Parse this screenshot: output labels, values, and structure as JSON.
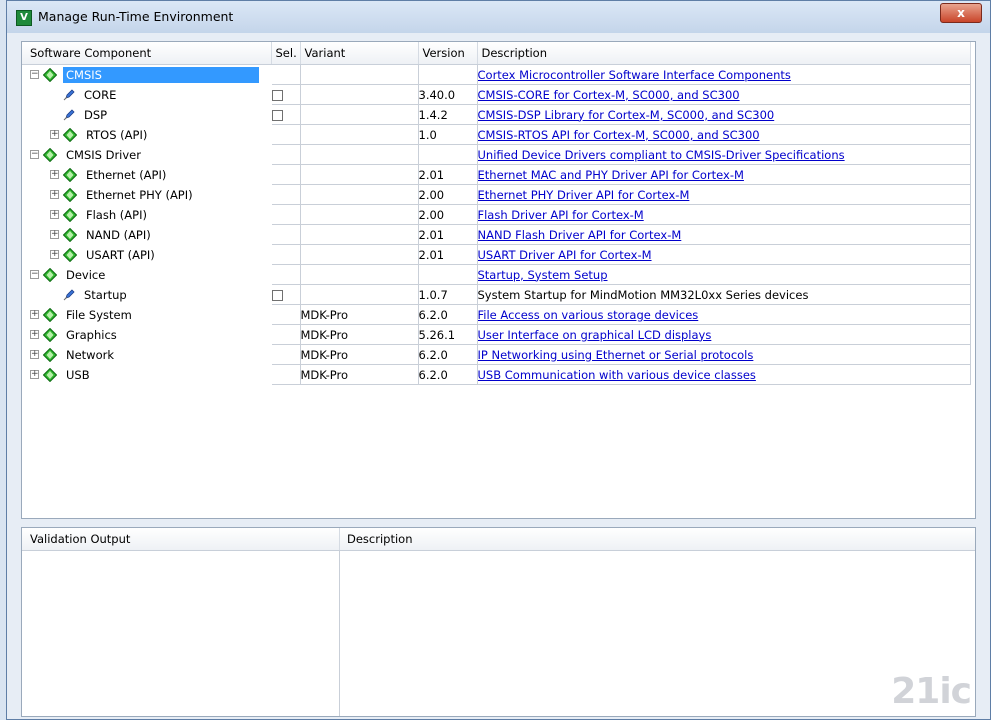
{
  "window": {
    "title": "Manage Run-Time Environment",
    "close_glyph": "x"
  },
  "columns": {
    "component": "Software Component",
    "sel": "Sel.",
    "variant": "Variant",
    "version": "Version",
    "description": "Description"
  },
  "rows": [
    {
      "name": "CMSIS",
      "level": 0,
      "icon": "diamond-icon",
      "expander": "minus",
      "selected": true,
      "checkbox": false,
      "variant": "",
      "version": "",
      "description": "Cortex Microcontroller Software Interface Components",
      "link": true
    },
    {
      "name": "CORE",
      "level": 1,
      "icon": "pin-icon",
      "expander": "none",
      "selected": false,
      "checkbox": true,
      "variant": "",
      "version": "3.40.0",
      "description": "CMSIS-CORE for Cortex-M, SC000, and SC300",
      "link": true
    },
    {
      "name": "DSP",
      "level": 1,
      "icon": "pin-icon",
      "expander": "none",
      "selected": false,
      "checkbox": true,
      "variant": "",
      "version": "1.4.2",
      "description": "CMSIS-DSP Library for Cortex-M, SC000, and SC300",
      "link": true
    },
    {
      "name": "RTOS (API)",
      "level": 1,
      "icon": "diamond-icon",
      "expander": "plus",
      "selected": false,
      "checkbox": false,
      "variant": "",
      "version": "1.0",
      "description": "CMSIS-RTOS API for Cortex-M, SC000, and SC300",
      "link": true
    },
    {
      "name": "CMSIS Driver",
      "level": 0,
      "icon": "diamond-icon",
      "expander": "minus",
      "selected": false,
      "checkbox": false,
      "variant": "",
      "version": "",
      "description": "Unified Device Drivers compliant to CMSIS-Driver Specifications",
      "link": true
    },
    {
      "name": "Ethernet (API)",
      "level": 1,
      "icon": "diamond-icon",
      "expander": "plus",
      "selected": false,
      "checkbox": false,
      "variant": "",
      "version": "2.01",
      "description": "Ethernet MAC and PHY Driver API for Cortex-M",
      "link": true
    },
    {
      "name": "Ethernet PHY (API)",
      "level": 1,
      "icon": "diamond-icon",
      "expander": "plus",
      "selected": false,
      "checkbox": false,
      "variant": "",
      "version": "2.00",
      "description": "Ethernet PHY Driver API for Cortex-M",
      "link": true
    },
    {
      "name": "Flash (API)",
      "level": 1,
      "icon": "diamond-icon",
      "expander": "plus",
      "selected": false,
      "checkbox": false,
      "variant": "",
      "version": "2.00",
      "description": "Flash Driver API for Cortex-M",
      "link": true
    },
    {
      "name": "NAND (API)",
      "level": 1,
      "icon": "diamond-icon",
      "expander": "plus",
      "selected": false,
      "checkbox": false,
      "variant": "",
      "version": "2.01",
      "description": "NAND Flash Driver API for Cortex-M",
      "link": true
    },
    {
      "name": "USART (API)",
      "level": 1,
      "icon": "diamond-icon",
      "expander": "plus",
      "selected": false,
      "checkbox": false,
      "variant": "",
      "version": "2.01",
      "description": "USART Driver API for Cortex-M",
      "link": true
    },
    {
      "name": "Device",
      "level": 0,
      "icon": "diamond-icon",
      "expander": "minus",
      "selected": false,
      "checkbox": false,
      "variant": "",
      "version": "",
      "description": "Startup, System Setup",
      "link": true
    },
    {
      "name": "Startup",
      "level": 1,
      "icon": "pin-icon",
      "expander": "none",
      "selected": false,
      "checkbox": true,
      "variant": "",
      "version": "1.0.7",
      "description": "System Startup for MindMotion MM32L0xx Series devices",
      "link": false
    },
    {
      "name": "File System",
      "level": 0,
      "icon": "diamond-icon",
      "expander": "plus",
      "selected": false,
      "checkbox": false,
      "variant": "MDK-Pro",
      "version": "6.2.0",
      "description": "File Access on various storage devices",
      "link": true
    },
    {
      "name": "Graphics",
      "level": 0,
      "icon": "diamond-icon",
      "expander": "plus",
      "selected": false,
      "checkbox": false,
      "variant": "MDK-Pro",
      "version": "5.26.1",
      "description": "User Interface on graphical LCD displays",
      "link": true
    },
    {
      "name": "Network",
      "level": 0,
      "icon": "diamond-icon",
      "expander": "plus",
      "selected": false,
      "checkbox": false,
      "variant": "MDK-Pro",
      "version": "6.2.0",
      "description": "IP Networking using Ethernet or Serial protocols",
      "link": true
    },
    {
      "name": "USB",
      "level": 0,
      "icon": "diamond-icon",
      "expander": "plus",
      "selected": false,
      "checkbox": false,
      "variant": "MDK-Pro",
      "version": "6.2.0",
      "description": "USB Communication with various device classes",
      "link": true
    }
  ],
  "validation": {
    "col_output": "Validation Output",
    "col_description": "Description"
  },
  "watermark": "21ic",
  "colors": {
    "selection": "#3399ff",
    "link": "#0000cc",
    "diamond": "#2db52d"
  }
}
